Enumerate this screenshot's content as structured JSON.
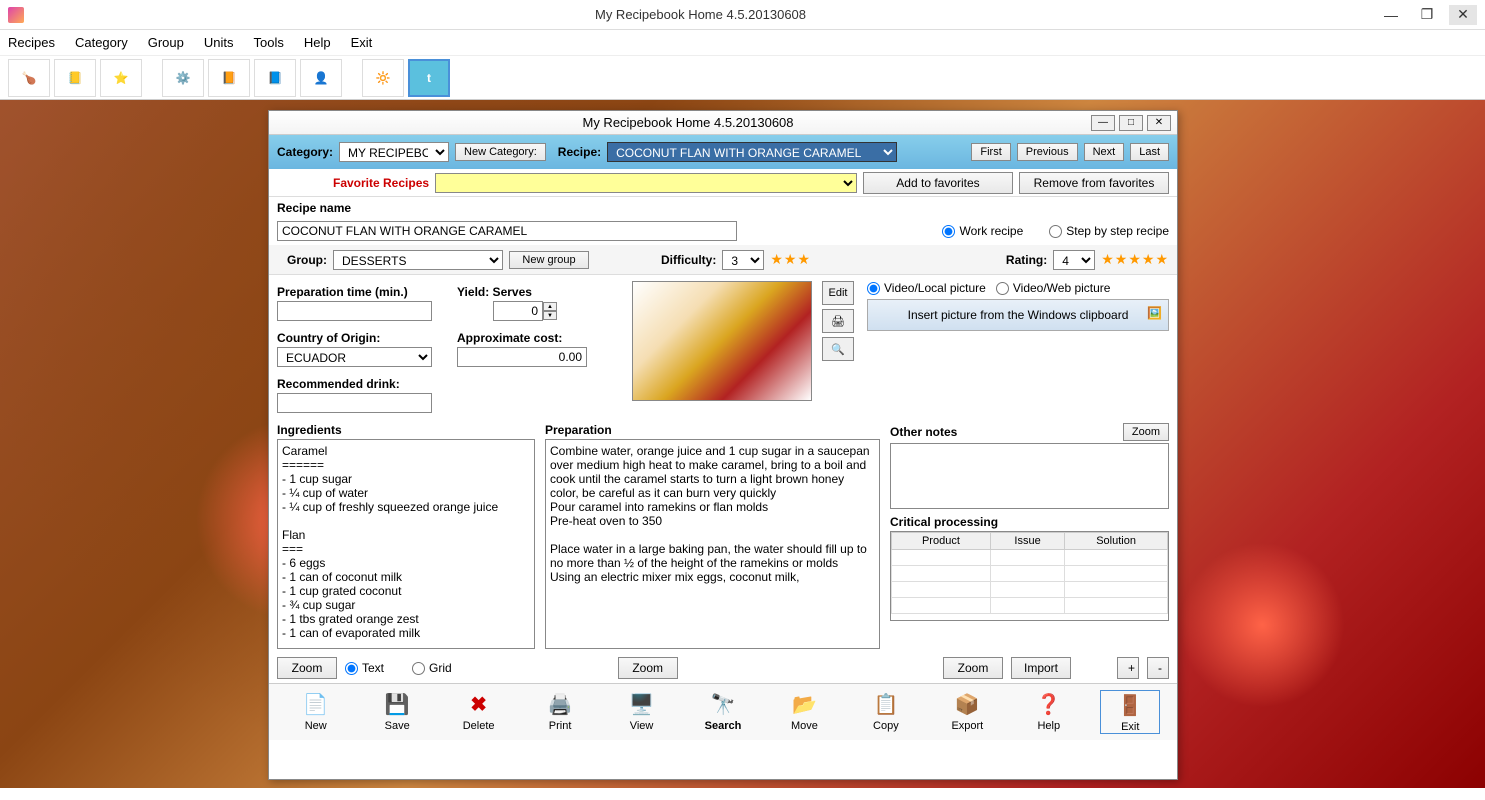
{
  "app_title": "My Recipebook Home 4.5.20130608",
  "menu": [
    "Recipes",
    "Category",
    "Group",
    "Units",
    "Tools",
    "Help",
    "Exit"
  ],
  "dialog": {
    "title": "My Recipebook Home 4.5.20130608",
    "category_lbl": "Category:",
    "category_val": "MY RECIPEBOOK",
    "new_category_btn": "New Category:",
    "recipe_lbl": "Recipe:",
    "recipe_val": "COCONUT FLAN WITH ORANGE CARAMEL",
    "nav": {
      "first": "First",
      "prev": "Previous",
      "next": "Next",
      "last": "Last"
    },
    "favorites_lbl": "Favorite Recipes",
    "add_fav": "Add to favorites",
    "remove_fav": "Remove from favorites",
    "recipe_name_lbl": "Recipe name",
    "recipe_name_val": "COCONUT FLAN WITH ORANGE CARAMEL",
    "work_recipe": "Work recipe",
    "step_recipe": "Step by step recipe",
    "group_lbl": "Group:",
    "group_val": "DESSERTS",
    "new_group_btn": "New group",
    "difficulty_lbl": "Difficulty:",
    "difficulty_val": "3",
    "rating_lbl": "Rating:",
    "rating_val": "4",
    "prep_time_lbl": "Preparation time (min.)",
    "prep_time_val": "",
    "yield_lbl": "Yield: Serves",
    "yield_val": "0",
    "country_lbl": "Country of Origin:",
    "country_val": "ECUADOR",
    "cost_lbl": "Approximate cost:",
    "cost_val": "0.00",
    "drink_lbl": "Recommended drink:",
    "drink_val": "",
    "edit_btn": "Edit",
    "video_local": "Video/Local picture",
    "video_web": "Video/Web picture",
    "insert_pic": "Insert picture from the Windows clipboard",
    "ingredients_lbl": "Ingredients",
    "ingredients_val": "Caramel\n======\n- 1 cup sugar\n- ¼ cup of water\n- ¼ cup of freshly squeezed orange juice\n\nFlan\n===\n- 6 eggs\n- 1 can of coconut milk\n- 1 cup grated coconut\n- ¾ cup sugar\n- 1 tbs grated orange zest\n- 1 can of evaporated milk",
    "preparation_lbl": "Preparation",
    "preparation_val": "Combine water, orange juice and 1 cup sugar in a saucepan over medium high heat to make caramel, bring to a boil and cook until the caramel starts to turn a light brown honey color, be careful as it can burn very quickly\nPour caramel into ramekins or flan molds\nPre-heat oven to 350\n\nPlace water in a large baking pan, the water should fill up to no more than ½ of the height of the ramekins or molds\nUsing an electric mixer mix eggs, coconut milk,",
    "notes_lbl": "Other notes",
    "notes_val": "",
    "crit_lbl": "Critical processing",
    "crit_cols": {
      "product": "Product",
      "issue": "Issue",
      "solution": "Solution"
    },
    "zoom_btn": "Zoom",
    "text_radio": "Text",
    "grid_radio": "Grid",
    "import_btn": "Import",
    "plus": "+",
    "minus": "-",
    "bottom": {
      "new": "New",
      "save": "Save",
      "delete": "Delete",
      "print": "Print",
      "view": "View",
      "search": "Search",
      "move": "Move",
      "copy": "Copy",
      "export": "Export",
      "help": "Help",
      "exit": "Exit"
    }
  }
}
